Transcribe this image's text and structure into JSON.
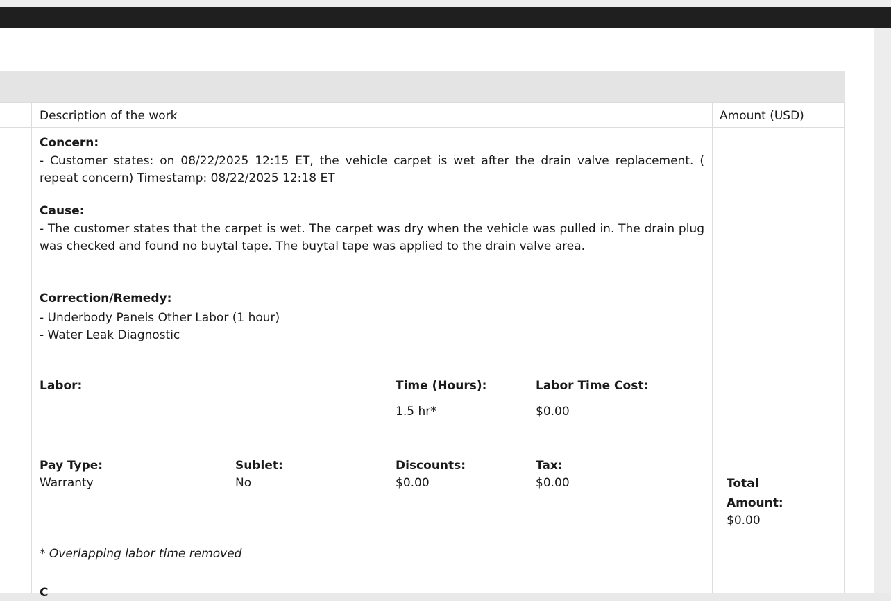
{
  "table": {
    "headers": {
      "description": "Description of the work",
      "amount": "Amount (USD)"
    }
  },
  "concern": {
    "label": "Concern:",
    "text": "- Customer states: on 08/22/2025 12:15 ET, the vehicle carpet is wet after the drain valve replacement. ( repeat concern) Timestamp: 08/22/2025 12:18 ET"
  },
  "cause": {
    "label": "Cause:",
    "text": "- The customer states that the carpet is wet. The carpet was dry when the vehicle was pulled in. The drain plug was checked and found no buytal tape. The buytal tape was applied to the drain valve area."
  },
  "correction": {
    "label": "Correction/Remedy:",
    "items": [
      "- Underbody Panels Other Labor (1 hour)",
      "- Water Leak Diagnostic"
    ]
  },
  "labor": {
    "label": "Labor:",
    "time_label": "Time (Hours):",
    "time_value": "1.5 hr*",
    "cost_label": "Labor Time Cost:",
    "cost_value": "$0.00"
  },
  "details": {
    "pay_type_label": "Pay Type:",
    "pay_type_value": "Warranty",
    "sublet_label": "Sublet:",
    "sublet_value": "No",
    "discounts_label": "Discounts:",
    "discounts_value": "$0.00",
    "tax_label": "Tax:",
    "tax_value": "$0.00"
  },
  "total": {
    "label_line1": "Total",
    "label_line2": "Amount:",
    "value": "$0.00"
  },
  "footnote": "* Overlapping labor time removed",
  "next_row_partial": "C"
}
